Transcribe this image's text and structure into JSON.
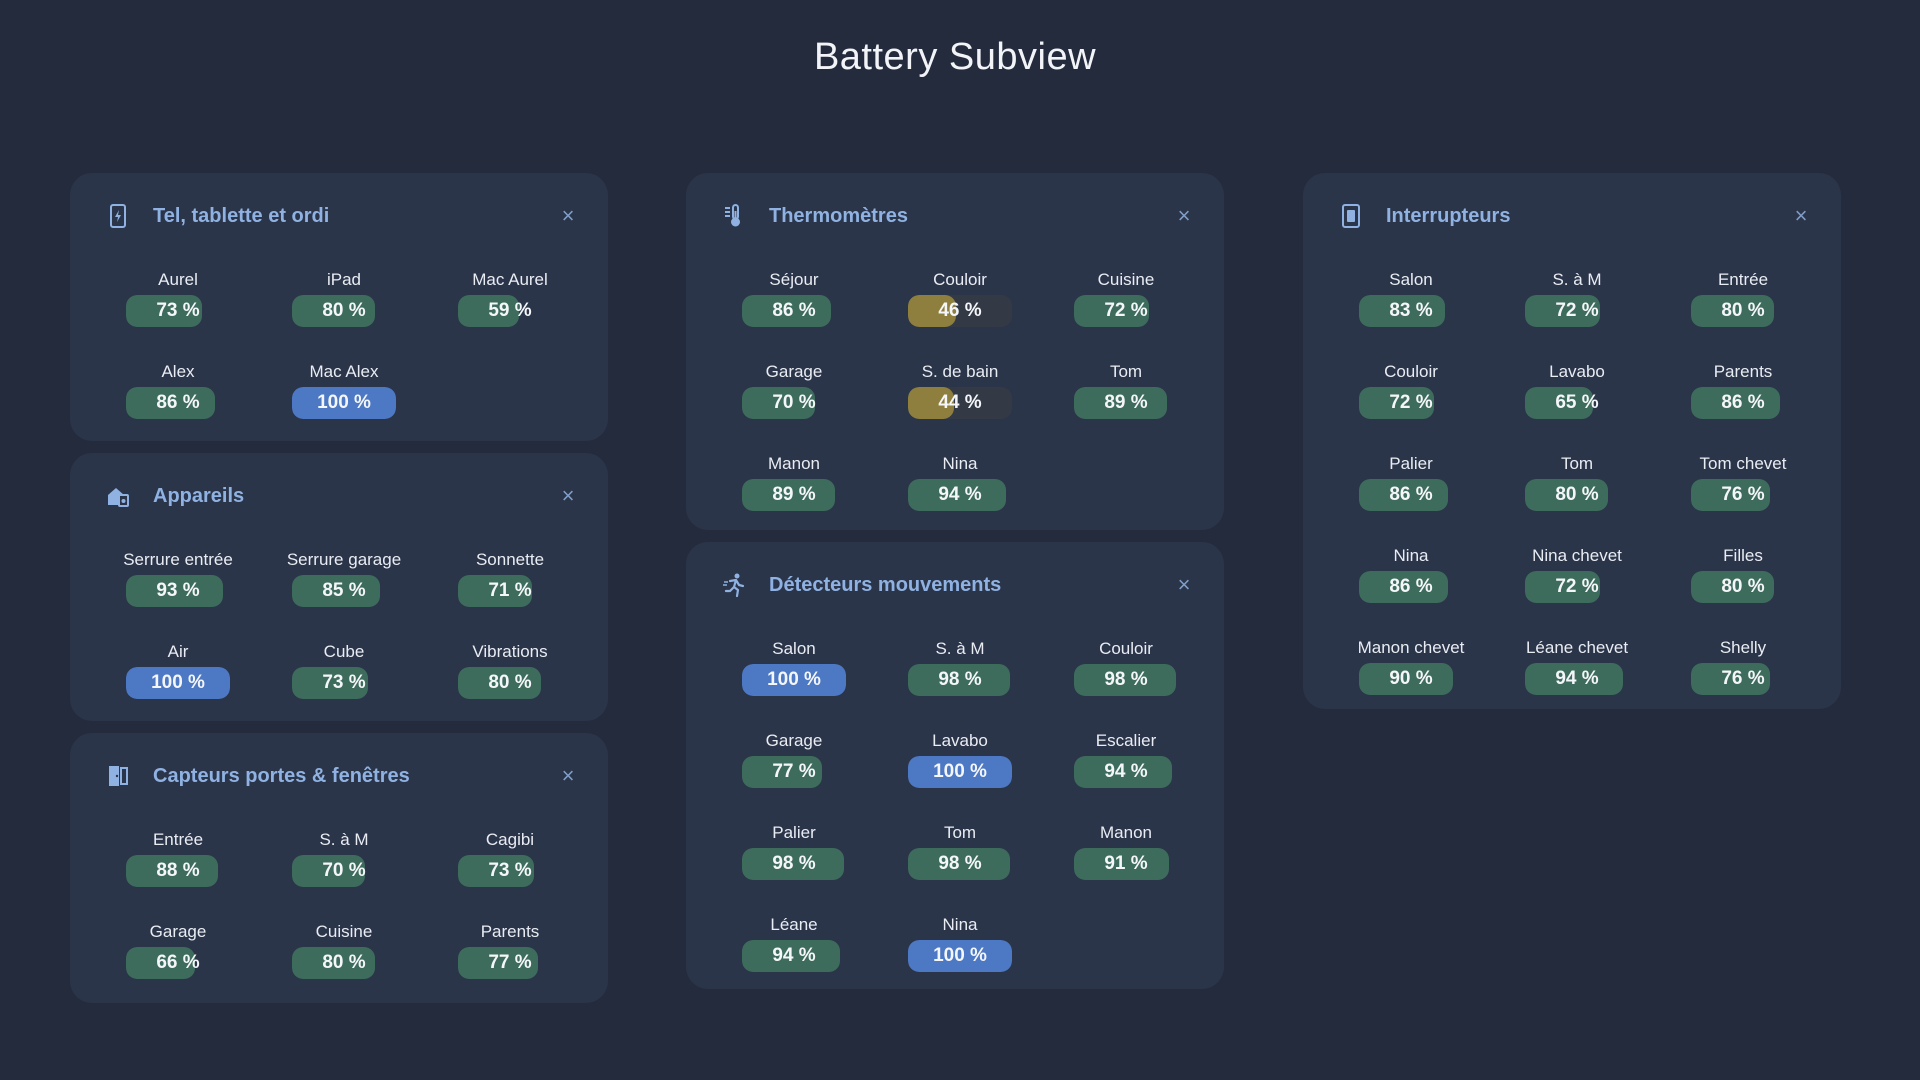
{
  "page": {
    "title": "Battery Subview"
  },
  "colors": {
    "background": "#232b3d",
    "card": "#2b354a",
    "title_accent": "#8fb2e2",
    "ok": "#3e6c5c",
    "full": "#4c78c4",
    "low": "#8e7f3e"
  },
  "cards": [
    {
      "id": "phones",
      "title": "Tel, tablette et ordi",
      "icon": "phone-charging-icon",
      "items": [
        {
          "name": "Aurel",
          "value": "73 %",
          "level": 73
        },
        {
          "name": "iPad",
          "value": "80 %",
          "level": 80
        },
        {
          "name": "Mac Aurel",
          "value": "59 %",
          "level": 59
        },
        {
          "name": "Alex",
          "value": "86 %",
          "level": 86
        },
        {
          "name": "Mac Alex",
          "value": "100 %",
          "level": 100
        }
      ]
    },
    {
      "id": "devices",
      "title": "Appareils",
      "icon": "home-devices-icon",
      "items": [
        {
          "name": "Serrure entrée",
          "value": "93 %",
          "level": 93
        },
        {
          "name": "Serrure garage",
          "value": "85 %",
          "level": 85
        },
        {
          "name": "Sonnette",
          "value": "71 %",
          "level": 71
        },
        {
          "name": "Air",
          "value": "100 %",
          "level": 100
        },
        {
          "name": "Cube",
          "value": "73 %",
          "level": 73
        },
        {
          "name": "Vibrations",
          "value": "80 %",
          "level": 80
        }
      ]
    },
    {
      "id": "doors",
      "title": "Capteurs portes & fenêtres",
      "icon": "door-sensor-icon",
      "items": [
        {
          "name": "Entrée",
          "value": "88 %",
          "level": 88
        },
        {
          "name": "S. à M",
          "value": "70 %",
          "level": 70
        },
        {
          "name": "Cagibi",
          "value": "73 %",
          "level": 73
        },
        {
          "name": "Garage",
          "value": "66 %",
          "level": 66
        },
        {
          "name": "Cuisine",
          "value": "80 %",
          "level": 80
        },
        {
          "name": "Parents",
          "value": "77 %",
          "level": 77
        }
      ]
    },
    {
      "id": "thermo",
      "title": "Thermomètres",
      "icon": "thermometer-icon",
      "items": [
        {
          "name": "Séjour",
          "value": "86 %",
          "level": 86
        },
        {
          "name": "Couloir",
          "value": "46 %",
          "level": 46
        },
        {
          "name": "Cuisine",
          "value": "72 %",
          "level": 72
        },
        {
          "name": "Garage",
          "value": "70 %",
          "level": 70
        },
        {
          "name": "S. de bain",
          "value": "44 %",
          "level": 44
        },
        {
          "name": "Tom",
          "value": "89 %",
          "level": 89
        },
        {
          "name": "Manon",
          "value": "89 %",
          "level": 89
        },
        {
          "name": "Nina",
          "value": "94 %",
          "level": 94
        }
      ]
    },
    {
      "id": "motion",
      "title": "Détecteurs mouvements",
      "icon": "motion-sensor-icon",
      "items": [
        {
          "name": "Salon",
          "value": "100 %",
          "level": 100
        },
        {
          "name": "S. à M",
          "value": "98 %",
          "level": 98
        },
        {
          "name": "Couloir",
          "value": "98 %",
          "level": 98
        },
        {
          "name": "Garage",
          "value": "77 %",
          "level": 77
        },
        {
          "name": "Lavabo",
          "value": "100 %",
          "level": 100
        },
        {
          "name": "Escalier",
          "value": "94 %",
          "level": 94
        },
        {
          "name": "Palier",
          "value": "98 %",
          "level": 98
        },
        {
          "name": "Tom",
          "value": "98 %",
          "level": 98
        },
        {
          "name": "Manon",
          "value": "91 %",
          "level": 91
        },
        {
          "name": "Léane",
          "value": "94 %",
          "level": 94
        },
        {
          "name": "Nina",
          "value": "100 %",
          "level": 100
        }
      ]
    },
    {
      "id": "switches",
      "title": "Interrupteurs",
      "icon": "switch-icon",
      "items": [
        {
          "name": "Salon",
          "value": "83 %",
          "level": 83
        },
        {
          "name": "S. à M",
          "value": "72 %",
          "level": 72
        },
        {
          "name": "Entrée",
          "value": "80 %",
          "level": 80
        },
        {
          "name": "Couloir",
          "value": "72 %",
          "level": 72
        },
        {
          "name": "Lavabo",
          "value": "65 %",
          "level": 65
        },
        {
          "name": "Parents",
          "value": "86 %",
          "level": 86
        },
        {
          "name": "Palier",
          "value": "86 %",
          "level": 86
        },
        {
          "name": "Tom",
          "value": "80 %",
          "level": 80
        },
        {
          "name": "Tom chevet",
          "value": "76 %",
          "level": 76
        },
        {
          "name": "Nina",
          "value": "86 %",
          "level": 86
        },
        {
          "name": "Nina chevet",
          "value": "72 %",
          "level": 72
        },
        {
          "name": "Filles",
          "value": "80 %",
          "level": 80
        },
        {
          "name": "Manon chevet",
          "value": "90 %",
          "level": 90
        },
        {
          "name": "Léane chevet",
          "value": "94 %",
          "level": 94
        },
        {
          "name": "Shelly",
          "value": "76 %",
          "level": 76
        }
      ]
    }
  ]
}
